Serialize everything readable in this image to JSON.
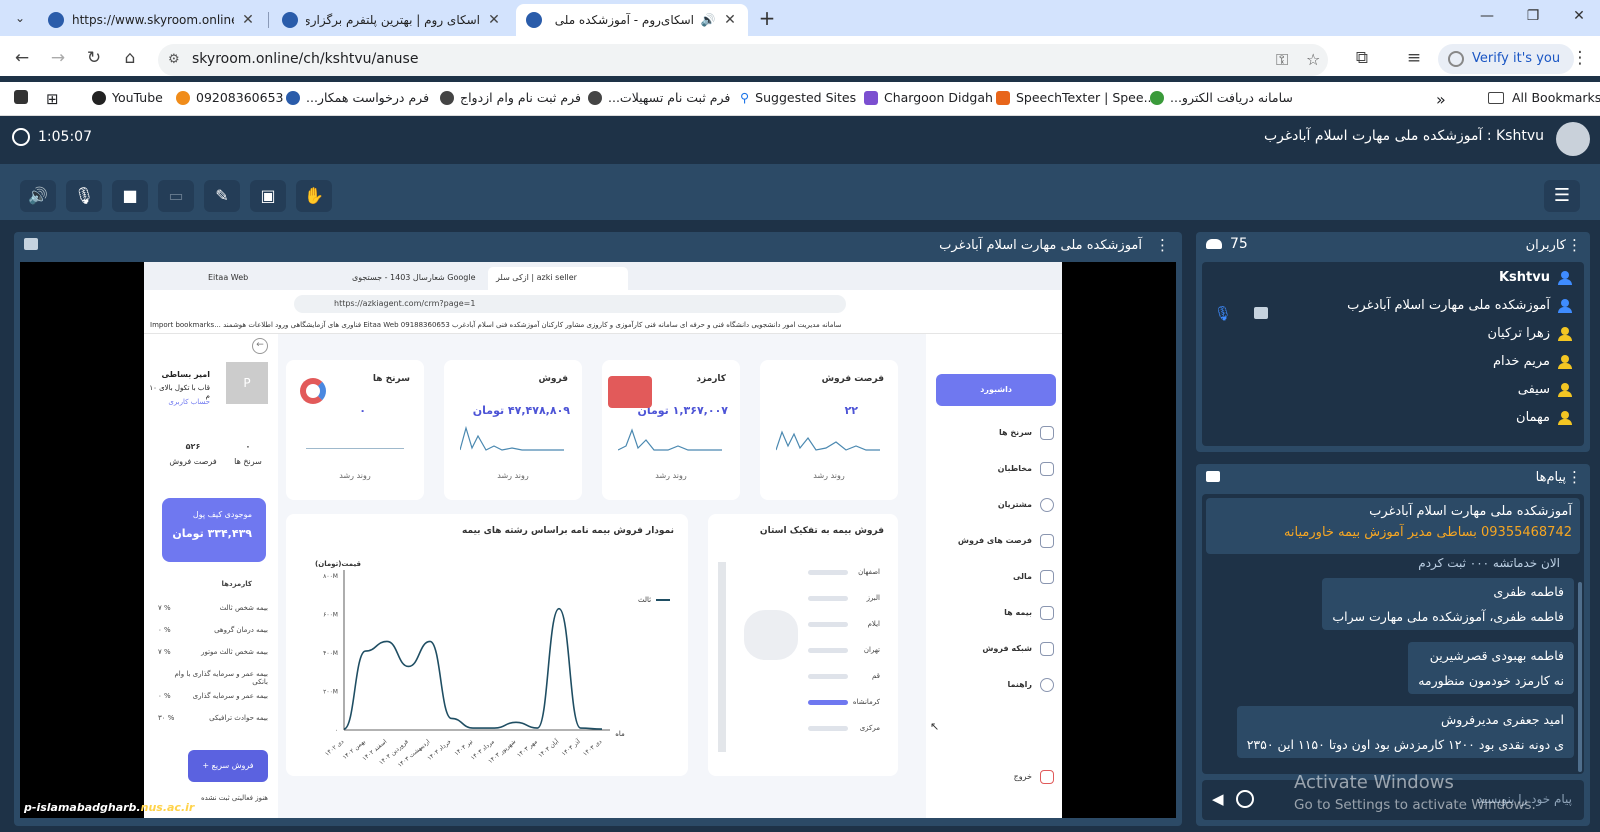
{
  "browser": {
    "tabs": [
      {
        "title": "https://www.skyroom.online/ch",
        "active": false
      },
      {
        "title": "اسکای روم | بهترین پلتفرم برگزاری",
        "active": false
      },
      {
        "title": "اسکای‌روم - آموزشکده ملی م",
        "active": true
      }
    ],
    "url": "skyroom.online/ch/kshtvu/anuse",
    "verify_label": "Verify it's you",
    "bookmarks": [
      {
        "label": "YouTube",
        "icon": "youtube-icon"
      },
      {
        "label": "09208360653",
        "icon": "page-icon"
      },
      {
        "label": "فرم درخواست همکار...",
        "icon": "form-icon"
      },
      {
        "label": "فرم ثبت نام وام ازدواج",
        "icon": "form-icon"
      },
      {
        "label": "فرم ثبت نام تسهیلات...",
        "icon": "form-icon"
      },
      {
        "label": "Suggested Sites",
        "icon": "search-icon"
      },
      {
        "label": "Chargoon Didgah",
        "icon": "chargoon-icon"
      },
      {
        "label": "SpeechTexter | Spee...",
        "icon": "speech-icon"
      },
      {
        "label": "سامانه دریافت الکترو...",
        "icon": "gear-icon"
      }
    ],
    "all_bookmarks_label": "All Bookmarks"
  },
  "app": {
    "timer": "1:05:07",
    "room_title": "Kshtvu : آموزشکده ملی مهارت اسلام آبادغرب",
    "presentation_title": "آموزشکده ملی مهارت اسلام آبادغرب",
    "watermark_prefix": "p-islamabadgharb.",
    "watermark_domain": "nus.ac.ir"
  },
  "shared_screen": {
    "tabs": [
      "Eitaa Web",
      "شعارسال 1403 - جستجوی Google",
      "ازکی سلر | azki seller"
    ],
    "url": "https://azkiagent.com/crm?page=1",
    "bookmarks_line": "Import bookmarks...   فناوری های آزمایشگاهی   ورود اطلاعات هوشمند   Eitaa Web 09188360653   سامانه مدیریت امور دانشجویی   دانشگاه فنی و حرفه ای   سامانه فنی کارآموزی و کاروزی   مشاور کارکنان   آموزشکده فنی اسلام آبادغرب",
    "nav": [
      "داشبورد",
      "سرنخ ها",
      "مخاطبان",
      "مشتریان",
      "فرصت های فروش",
      "مالی",
      "بیمه ها",
      "شبکه فروش",
      "راهنما",
      "خروج"
    ],
    "cards": [
      {
        "title": "فرصت فروش",
        "value": "۲۲",
        "sub": "روند رشد"
      },
      {
        "title": "کارمزد",
        "value": "۱,۳۶۷,۰۰۷ تومان",
        "sub": "روند رشد"
      },
      {
        "title": "فروش",
        "value": "۴۷,۴۷۸,۸۰۹ تومان",
        "sub": "روند رشد"
      },
      {
        "title": "سرنخ ها",
        "value": "۰",
        "sub": "روند رشد"
      }
    ],
    "province_chart_title": "فروش بیمه به تفکیک استان",
    "provinces": [
      "اصفهان",
      "البرز",
      "ایلام",
      "تهران",
      "قم",
      "کرمانشاه",
      "مرکزی"
    ],
    "line_chart_title": "نمودار فروش بیمه نامه براساس رشته های بیمه",
    "user": {
      "name": "امیر بساطی",
      "line2": "قاب با تکول بالای ۱۰ م",
      "link": "حساب کاربری",
      "avatar_letter": "P"
    },
    "stats": [
      {
        "value": "۵۲۶",
        "label": "فرصت فروش"
      },
      {
        "value": "۰",
        "label": "سرنخ ها"
      }
    ],
    "wallet": {
      "label": "موجودی کیف پول",
      "value": "۳۳۴,۴۳۹ تومان"
    },
    "commissions_label": "کارمزدها",
    "commissions": [
      {
        "label": "بیمه شخص ثالث",
        "pct": "۷ %"
      },
      {
        "label": "بیمه درمان گروهی",
        "pct": "۰ %"
      },
      {
        "label": "بیمه شخص ثالث موتور",
        "pct": "۷ %"
      },
      {
        "label": "بیمه عمر و سرمایه گذاری با وام بانکی",
        "pct": ""
      },
      {
        "label": "بیمه عمر و سرمایه گذاری",
        "pct": "۰ %"
      },
      {
        "label": "بیمه حوادث ترافیکی",
        "pct": "۳۰ %"
      }
    ],
    "quick_sale_label": "فروش سریع",
    "footer_note": "هنوز فعالیتی ثبت نشده"
  },
  "chart_data": {
    "type": "line",
    "title": "نمودار فروش بیمه نامه براساس رشته های بیمه",
    "ylabel": "قیمت(تومان)",
    "xlabel": "ماه",
    "legend": [
      "ثالث"
    ],
    "legend_position": "top-left",
    "y_ticks": [
      "۰",
      "۲۰۰M",
      "۴۰۰M",
      "۶۰۰M",
      "۸۰۰M"
    ],
    "ylim": [
      0,
      800
    ],
    "categories": [
      "دی ۱۴۰۲",
      "بهمن ۱۴۰۲",
      "اسفند ۱۴۰۲",
      "فروردین ۱۴۰۳",
      "اردیبهشت ۱۴۰۳",
      "خرداد ۱۴۰۳",
      "تیر ۱۴۰۳",
      "مرداد ۱۴۰۳",
      "شهریور ۱۴۰۳",
      "مهر ۱۴۰۳",
      "آبان ۱۴۰۳",
      "آذر ۱۴۰۳",
      "دی ۱۴۰۳"
    ],
    "series": [
      {
        "name": "ثالث",
        "values": [
          5,
          410,
          460,
          330,
          460,
          60,
          10,
          10,
          40,
          10,
          630,
          10,
          5
        ]
      }
    ],
    "color": "#1f4e63"
  },
  "users": {
    "title": "کاربران",
    "count": "75",
    "list": [
      {
        "name": "Kshtvu",
        "color": "#3f8cff",
        "bold": true
      },
      {
        "name": "آموزشکده ملی مهارت اسلام آبادغرب",
        "color": "#3f8cff",
        "bold": false
      },
      {
        "name": "زهرا ترکیان",
        "color": "#f3c623",
        "bold": false
      },
      {
        "name": "مریم خدام",
        "color": "#f3c623",
        "bold": false
      },
      {
        "name": "سیفی",
        "color": "#f3c623",
        "bold": false
      },
      {
        "name": "مهمان",
        "color": "#f3c623",
        "bold": false
      }
    ]
  },
  "messages": {
    "title": "پیام‌ها",
    "pinned_line1": "آموزشکده ملی مهارت اسلام آبادغرب",
    "pinned_line2": "09355468742 بساطی مدیر آموزش بیمه خاورمیانه",
    "partial_text": "الان خدماتشه ۰۰۰ ثبت کردم",
    "items": [
      {
        "sender": "فاطمه ظفری",
        "text": "فاطمه ظفری، آموزشکده ملی مهارت سراب"
      },
      {
        "sender": "فاطمه بهبودی قصرشیرین",
        "text": "نه کارمزد خودمون منظورمه"
      },
      {
        "sender": "امید جعفری مدیرفروش",
        "text": "ی دونه نقدی بود ۱۲۰۰ کارمزدش بود اون دوتا ۱۱۵۰ این ۲۳۵۰"
      }
    ],
    "input_placeholder": "پیام خود را بنویسید"
  },
  "windows_watermark": {
    "line1": "Activate Windows",
    "line2": "Go to Settings to activate Windows."
  }
}
